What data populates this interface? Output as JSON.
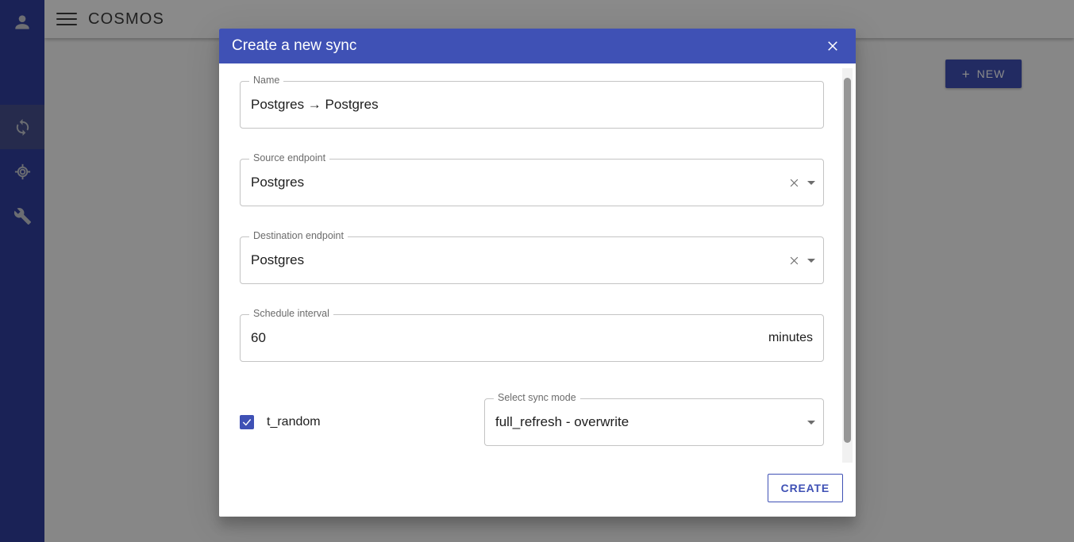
{
  "sidebar": {
    "avatar_icon": "account-circle-icon",
    "items": [
      {
        "icon": "sync-icon",
        "name": "syncs",
        "active": true
      },
      {
        "icon": "crosshair-target-icon",
        "name": "endpoints",
        "active": false
      },
      {
        "icon": "wrench-icon",
        "name": "tools",
        "active": false
      }
    ]
  },
  "appbar": {
    "menu_icon": "hamburger-menu-icon",
    "title": "COSMOS"
  },
  "content": {
    "new_button_label": "NEW",
    "new_button_icon": "plus-icon"
  },
  "dialog": {
    "title": "Create a new sync",
    "close_icon": "close-icon",
    "fields": [
      {
        "label": "Name",
        "value": "Postgres → Postgres",
        "type": "text",
        "name": "name"
      },
      {
        "label": "Source endpoint",
        "value": "Postgres",
        "type": "select",
        "name": "source-endpoint",
        "clear_icon": "clear-x-icon",
        "dropdown_icon": "chevron-down-icon"
      },
      {
        "label": "Destination endpoint",
        "value": "Postgres",
        "type": "select",
        "name": "destination-endpoint",
        "clear_icon": "clear-x-icon",
        "dropdown_icon": "chevron-down-icon"
      },
      {
        "label": "Schedule interval",
        "value": "60",
        "suffix": "minutes",
        "type": "number",
        "name": "schedule-interval"
      }
    ],
    "stream": {
      "checked": true,
      "label": "t_random",
      "check_icon": "checkmark-icon"
    },
    "sync_mode": {
      "label": "Select sync mode",
      "value": "full_refresh - overwrite",
      "dropdown_icon": "chevron-down-icon"
    },
    "create_button_label": "CREATE"
  },
  "colors": {
    "primary": "#3f51b5",
    "sidebar": "#303f9f",
    "sidebar_active": "#46518f",
    "overlay": "rgba(0,0,0,0.46)"
  }
}
